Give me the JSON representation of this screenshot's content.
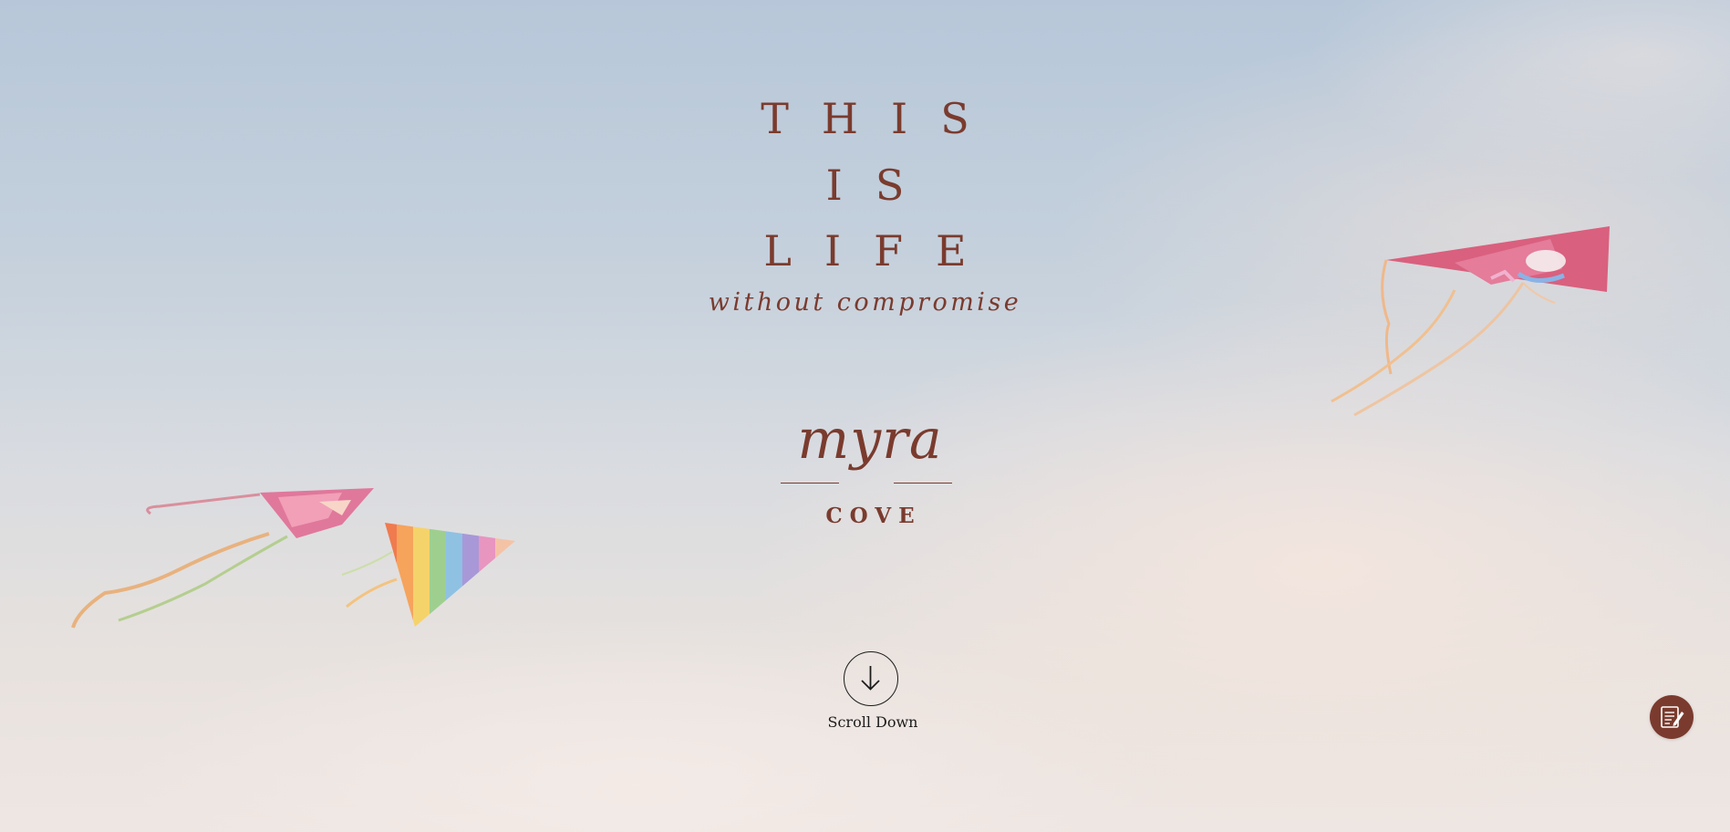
{
  "hero": {
    "headline_line1": "THIS",
    "headline_line2": "IS",
    "headline_line3": "LIFE",
    "subtitle": "without compromise"
  },
  "logo": {
    "script": "myra",
    "word": "COVE"
  },
  "scroll": {
    "label": "Scroll Down",
    "icon": "arrow-down-icon"
  },
  "fab": {
    "icon": "notepad-edit-icon"
  },
  "colors": {
    "brand": "#7a3b2e",
    "text_dark": "#1c1c1c",
    "sky_top": "#b7c7d9",
    "sky_bottom": "#eee6e2"
  }
}
